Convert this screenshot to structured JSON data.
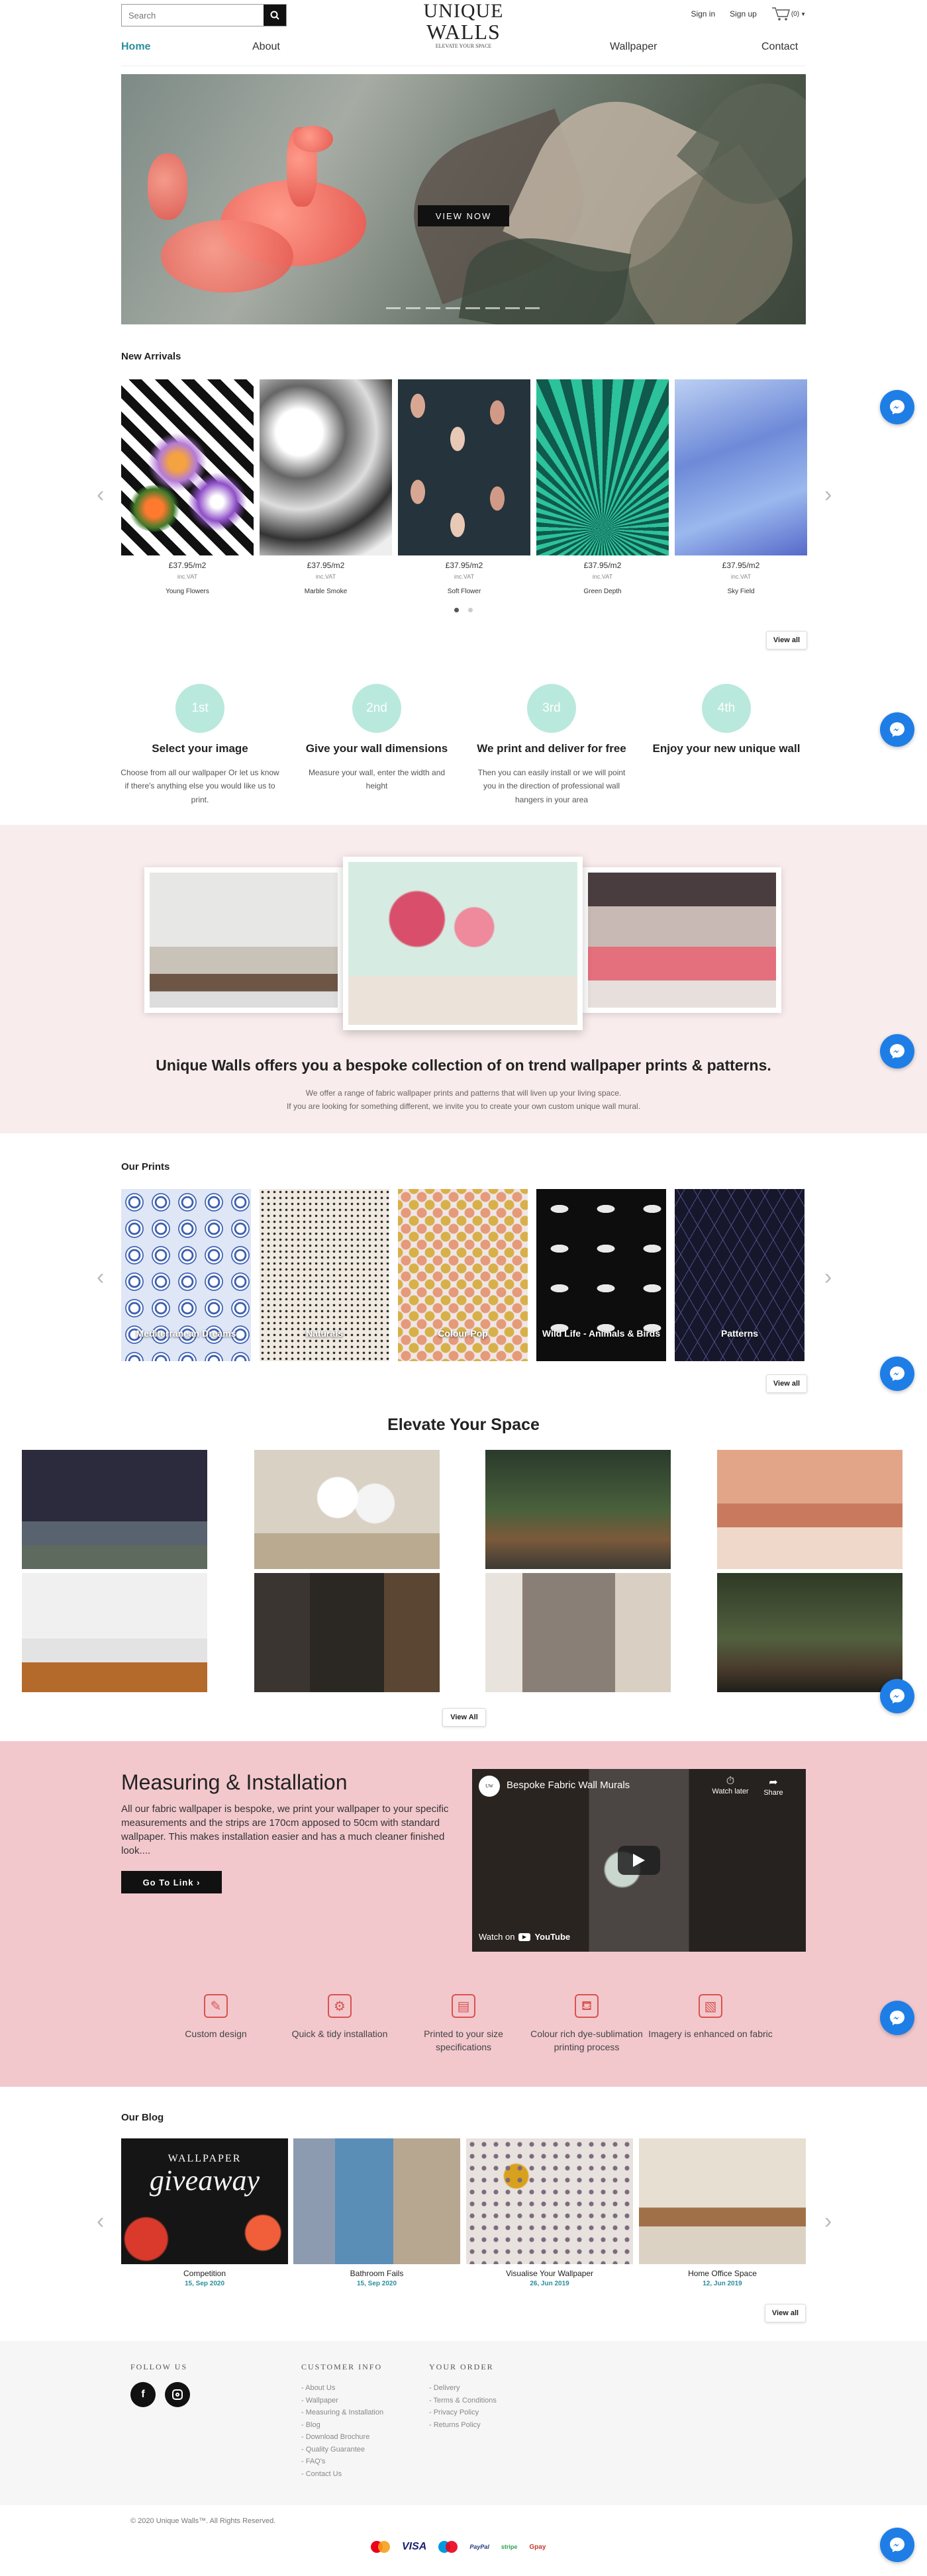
{
  "header": {
    "search_placeholder": "Search",
    "logo_line1": "UNIQUE",
    "logo_line2": "WALLS",
    "logo_tagline": "ELEVATE YOUR SPACE",
    "signin": "Sign in",
    "signup": "Sign up",
    "cart": "(0)",
    "nav": [
      "Home",
      "About",
      "Wallpaper",
      "Contact"
    ]
  },
  "hero": {
    "button": "VIEW NOW"
  },
  "new_arrivals": {
    "title": "New Arrivals",
    "view_all": "View all",
    "items": [
      {
        "price": "£37.95/m2",
        "vat": "inc.VAT",
        "name": "Young Flowers"
      },
      {
        "price": "£37.95/m2",
        "vat": "inc.VAT",
        "name": "Marble Smoke"
      },
      {
        "price": "£37.95/m2",
        "vat": "inc.VAT",
        "name": "Soft Flower"
      },
      {
        "price": "£37.95/m2",
        "vat": "inc.VAT",
        "name": "Green Depth"
      },
      {
        "price": "£37.95/m2",
        "vat": "inc.VAT",
        "name": "Sky Field"
      }
    ]
  },
  "steps": [
    {
      "num": "1st",
      "title": "Select your image",
      "desc": "Choose from all our wallpaper Or let us know if there's anything else you would like us to print."
    },
    {
      "num": "2nd",
      "title": "Give your wall dimensions",
      "desc": "Measure your wall, enter the width and height"
    },
    {
      "num": "3rd",
      "title": "We print and deliver for free",
      "desc": "Then you can easily install or we will point you in the direction of professional wall hangers in your area"
    },
    {
      "num": "4th",
      "title": "Enjoy your new unique wall",
      "desc": ""
    }
  ],
  "bespoke": {
    "title": "Unique Walls offers you a bespoke collection of on trend wallpaper prints & patterns.",
    "line1": "We offer a range of fabric wallpaper prints and patterns that will liven up your living space.",
    "line2": "If you are looking for something different, we invite you to create your own custom unique wall mural."
  },
  "our_prints": {
    "title": "Our Prints",
    "view_all": "View all",
    "items": [
      "Mediterranean Dreams",
      "Naturals",
      "Colour Pop",
      "Wild Life - Animals & Birds",
      "Patterns"
    ]
  },
  "elevate": {
    "title": "Elevate Your Space",
    "view_all": "View All"
  },
  "measuring": {
    "title": "Measuring & Installation",
    "text": "All our fabric wallpaper is bespoke, we print your wallpaper to your specific measurements and the strips are 170cm apposed to 50cm with standard wallpaper. This makes installation easier and has a much cleaner finished look....",
    "button": "Go To Link  ›",
    "video_title": "Bespoke Fabric Wall Murals",
    "watch_later": "Watch later",
    "share": "Share",
    "watch_on": "Watch on",
    "youtube": "YouTube"
  },
  "features": [
    "Custom design",
    "Quick & tidy installation",
    "Printed to your size specifications",
    "Colour rich dye-sublimation printing process",
    "Imagery is enhanced on fabric"
  ],
  "blog": {
    "title": "Our Blog",
    "view_all": "View all",
    "giveaway_top": "WALLPAPER",
    "giveaway_main": "giveaway",
    "posts": [
      {
        "title": "Competition",
        "date": "15, Sep 2020"
      },
      {
        "title": "Bathroom Fails",
        "date": "15, Sep 2020"
      },
      {
        "title": "Visualise Your Wallpaper",
        "date": "26, Jun 2019"
      },
      {
        "title": "Home Office Space",
        "date": "12, Jun 2019"
      }
    ]
  },
  "footer": {
    "follow": "FOLLOW US",
    "customer_info": "CUSTOMER INFO",
    "your_order": "YOUR ORDER",
    "info_links": [
      "About Us",
      "Wallpaper",
      "Measuring & Installation",
      "Blog",
      "Download Brochure",
      "Quality Guarantee",
      "FAQ's",
      "Contact Us"
    ],
    "order_links": [
      "Delivery",
      "Terms & Conditions",
      "Privacy Policy",
      "Returns Policy"
    ],
    "copyright": "© 2020 Unique Walls™. All Rights Reserved.",
    "payments": [
      "mastercard",
      "VISA",
      "maestro",
      "PayPal",
      "stripe",
      "Gpay"
    ]
  },
  "colors": {
    "accent": "#2a8e9e",
    "step_circle": "#b9e9dc",
    "pink_band": "#f9ecec",
    "measuring_bg": "#f2c8cd",
    "feature_icon": "#d9534f",
    "messenger": "#1e7ee6"
  }
}
